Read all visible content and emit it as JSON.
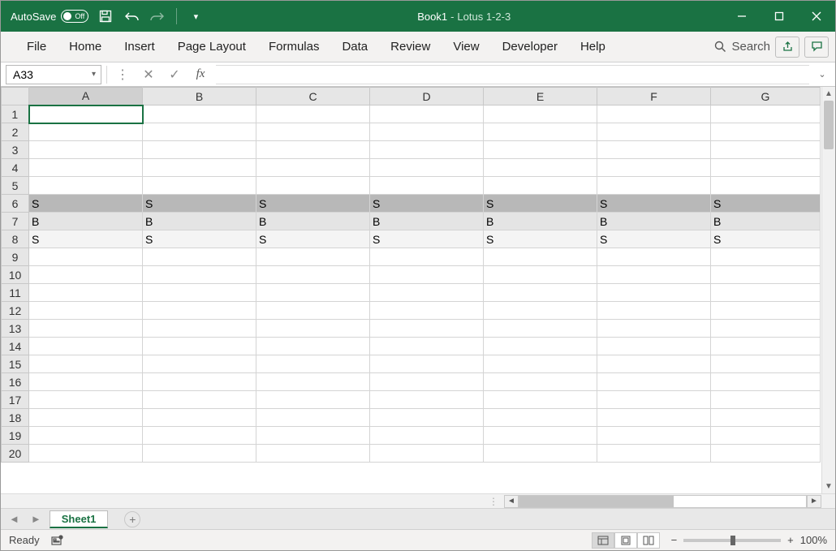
{
  "titlebar": {
    "autosave_label": "AutoSave",
    "autosave_state": "Off",
    "book_name": "Book1",
    "separator": "  -  ",
    "app_name": "Lotus 1-2-3"
  },
  "ribbon": {
    "tabs": [
      "File",
      "Home",
      "Insert",
      "Page Layout",
      "Formulas",
      "Data",
      "Review",
      "View",
      "Developer",
      "Help"
    ],
    "search_label": "Search"
  },
  "formula_bar": {
    "name_box": "A33",
    "fx_label": "fx",
    "formula_value": ""
  },
  "grid": {
    "columns": [
      "A",
      "B",
      "C",
      "D",
      "E",
      "F",
      "G"
    ],
    "row_count": 20,
    "selected_cell": "A1",
    "selected_column": "A",
    "rows_data": {
      "6": [
        "S",
        "S",
        "S",
        "S",
        "S",
        "S",
        "S"
      ],
      "7": [
        "B",
        "B",
        "B",
        "B",
        "B",
        "B",
        "B"
      ],
      "8": [
        "S",
        "S",
        "S",
        "S",
        "S",
        "S",
        "S"
      ]
    },
    "row_shades": {
      "6": "dark",
      "7": "med",
      "8": "lite"
    }
  },
  "horizontal_scroll": {
    "dots": "⋮"
  },
  "sheet_tabs": {
    "nav_left": "◄",
    "nav_right": "►",
    "active": "Sheet1",
    "add": "+"
  },
  "statusbar": {
    "ready": "Ready",
    "zoom_pct": "100%",
    "zoom_minus": "−",
    "zoom_plus": "+"
  }
}
